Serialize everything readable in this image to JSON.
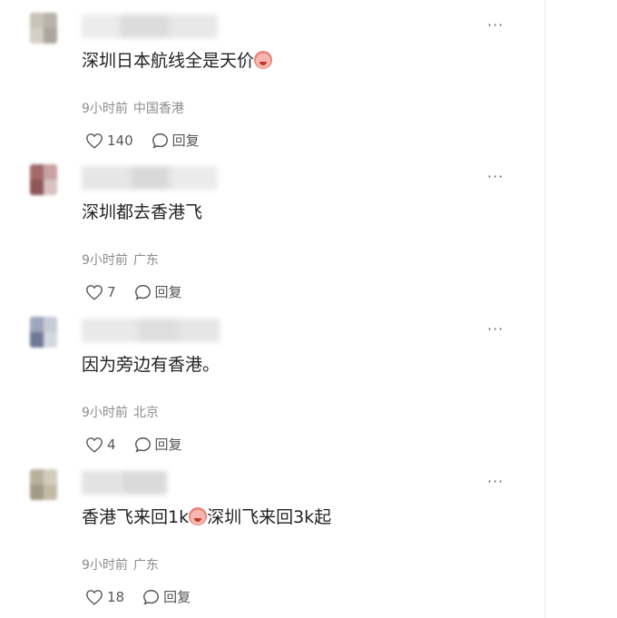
{
  "comments": [
    {
      "text": "深圳日本航线全是天价",
      "text_emoji_after": true,
      "time": "9小时前",
      "location": "中国香港",
      "likes": "140",
      "reply_label": "回复",
      "more_label": "···"
    },
    {
      "text": "深圳都去香港飞",
      "time": "9小时前",
      "location": "广东",
      "likes": "7",
      "reply_label": "回复",
      "more_label": "···"
    },
    {
      "text": "因为旁边有香港。",
      "time": "9小时前",
      "location": "北京",
      "likes": "4",
      "reply_label": "回复",
      "more_label": "···"
    },
    {
      "text_part1": "香港飞来回1k",
      "text_part2": "深圳飞来回3k起",
      "time": "9小时前",
      "location": "广东",
      "likes": "18",
      "reply_label": "回复",
      "more_label": "···"
    }
  ],
  "icons": {
    "like": "heart-outline-icon",
    "reply": "speech-bubble-icon",
    "more": "ellipsis-icon",
    "emoji": "crying-face-emoji"
  },
  "colors": {
    "text": "#222222",
    "meta": "#8c8c8c",
    "divider": "#ececec"
  }
}
